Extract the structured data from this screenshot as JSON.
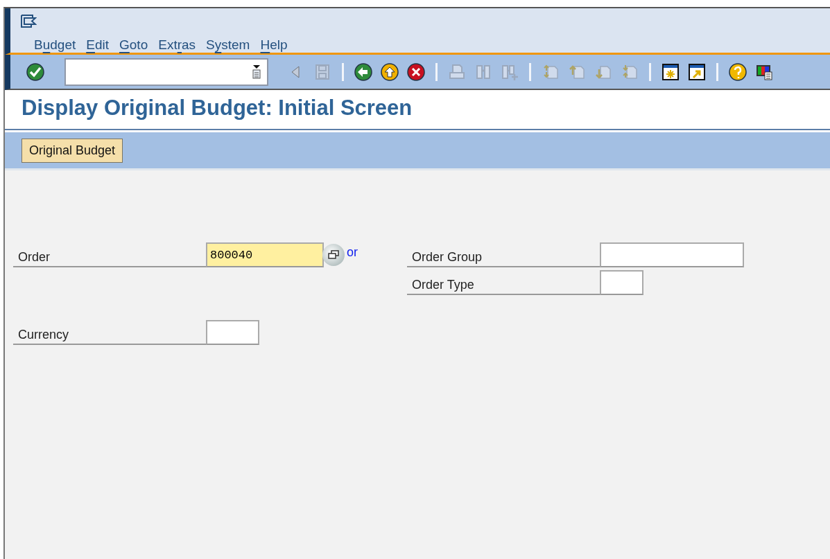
{
  "menu": [
    {
      "label_start": "B",
      "access_key": "u",
      "label_end": "dget"
    },
    {
      "access_key": "E",
      "label_end": "dit"
    },
    {
      "access_key": "G",
      "label_end": "oto"
    },
    {
      "label_start": "Ext",
      "access_key": "r",
      "label_end": "as"
    },
    {
      "label_start": "S",
      "access_key": "y",
      "label_end": "stem"
    },
    {
      "access_key": "H",
      "label_end": "elp"
    }
  ],
  "toolbar": [
    {
      "kind": "enter",
      "disabled": false
    },
    {
      "kind": "command_field"
    },
    {
      "kind": "previous",
      "disabled": true
    },
    {
      "kind": "save",
      "disabled": true
    },
    {
      "kind": "separator"
    },
    {
      "kind": "back",
      "disabled": false
    },
    {
      "kind": "exit",
      "disabled": false
    },
    {
      "kind": "cancel",
      "disabled": false
    },
    {
      "kind": "separator"
    },
    {
      "kind": "print",
      "disabled": true
    },
    {
      "kind": "find",
      "disabled": true
    },
    {
      "kind": "find_next",
      "disabled": true
    },
    {
      "kind": "separator"
    },
    {
      "kind": "first_page",
      "disabled": true
    },
    {
      "kind": "previous_page",
      "disabled": true
    },
    {
      "kind": "next_page",
      "disabled": true
    },
    {
      "kind": "last_page",
      "disabled": true
    },
    {
      "kind": "separator"
    },
    {
      "kind": "new_session",
      "disabled": false
    },
    {
      "kind": "shortcut",
      "disabled": false
    },
    {
      "kind": "separator"
    },
    {
      "kind": "help",
      "disabled": false
    },
    {
      "kind": "layout",
      "disabled": false
    }
  ],
  "title": "Display Original Budget: Initial Screen",
  "app_toolbar": [
    {
      "label": "Original Budget"
    }
  ],
  "form": {
    "order": {
      "label": "Order",
      "value": "800040",
      "focused": true
    },
    "or_text": "or",
    "order_group": {
      "label": "Order Group"
    },
    "order_type": {
      "label": "Order Type"
    },
    "currency": {
      "label": "Currency"
    }
  }
}
